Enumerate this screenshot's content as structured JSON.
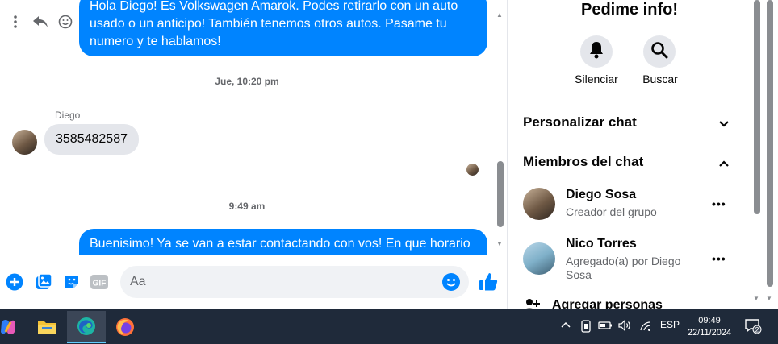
{
  "chat": {
    "messages": [
      {
        "type": "outgoing",
        "text": "Hola Diego! Es Volkswagen Amarok. Podes retirarlo con un auto usado o un anticipo! También tenemos otros autos. Pasame tu numero y te hablamos!"
      },
      {
        "type": "timestamp",
        "text": "Jue, 10:20 pm"
      },
      {
        "type": "sender",
        "text": "Diego"
      },
      {
        "type": "incoming",
        "text": "3585482587"
      },
      {
        "type": "timestamp",
        "text": "9:49 am"
      },
      {
        "type": "outgoing",
        "text": "Buenisimo! Ya se van a estar contactando con vos! En que horario"
      }
    ]
  },
  "composer": {
    "placeholder": "Aa"
  },
  "panel": {
    "title": "Pedime info!",
    "actions": [
      {
        "label": "Silenciar",
        "icon": "bell-icon"
      },
      {
        "label": "Buscar",
        "icon": "search-icon"
      }
    ],
    "sections": {
      "customize": "Personalizar chat",
      "members": "Miembros del chat"
    },
    "members": [
      {
        "name": "Diego Sosa",
        "role": "Creador del grupo"
      },
      {
        "name": "Nico Torres",
        "role": "Agregado(a) por Diego Sosa"
      }
    ],
    "add_people": "Agregar personas"
  },
  "taskbar": {
    "apps": [
      "copilot-icon",
      "file-explorer-icon",
      "edge-icon",
      "firefox-icon"
    ],
    "language": "ESP",
    "time": "09:49",
    "date": "22/11/2024",
    "notifications": "2"
  },
  "colors": {
    "accent": "#0084ff",
    "taskbar": "#1f2a3a"
  }
}
